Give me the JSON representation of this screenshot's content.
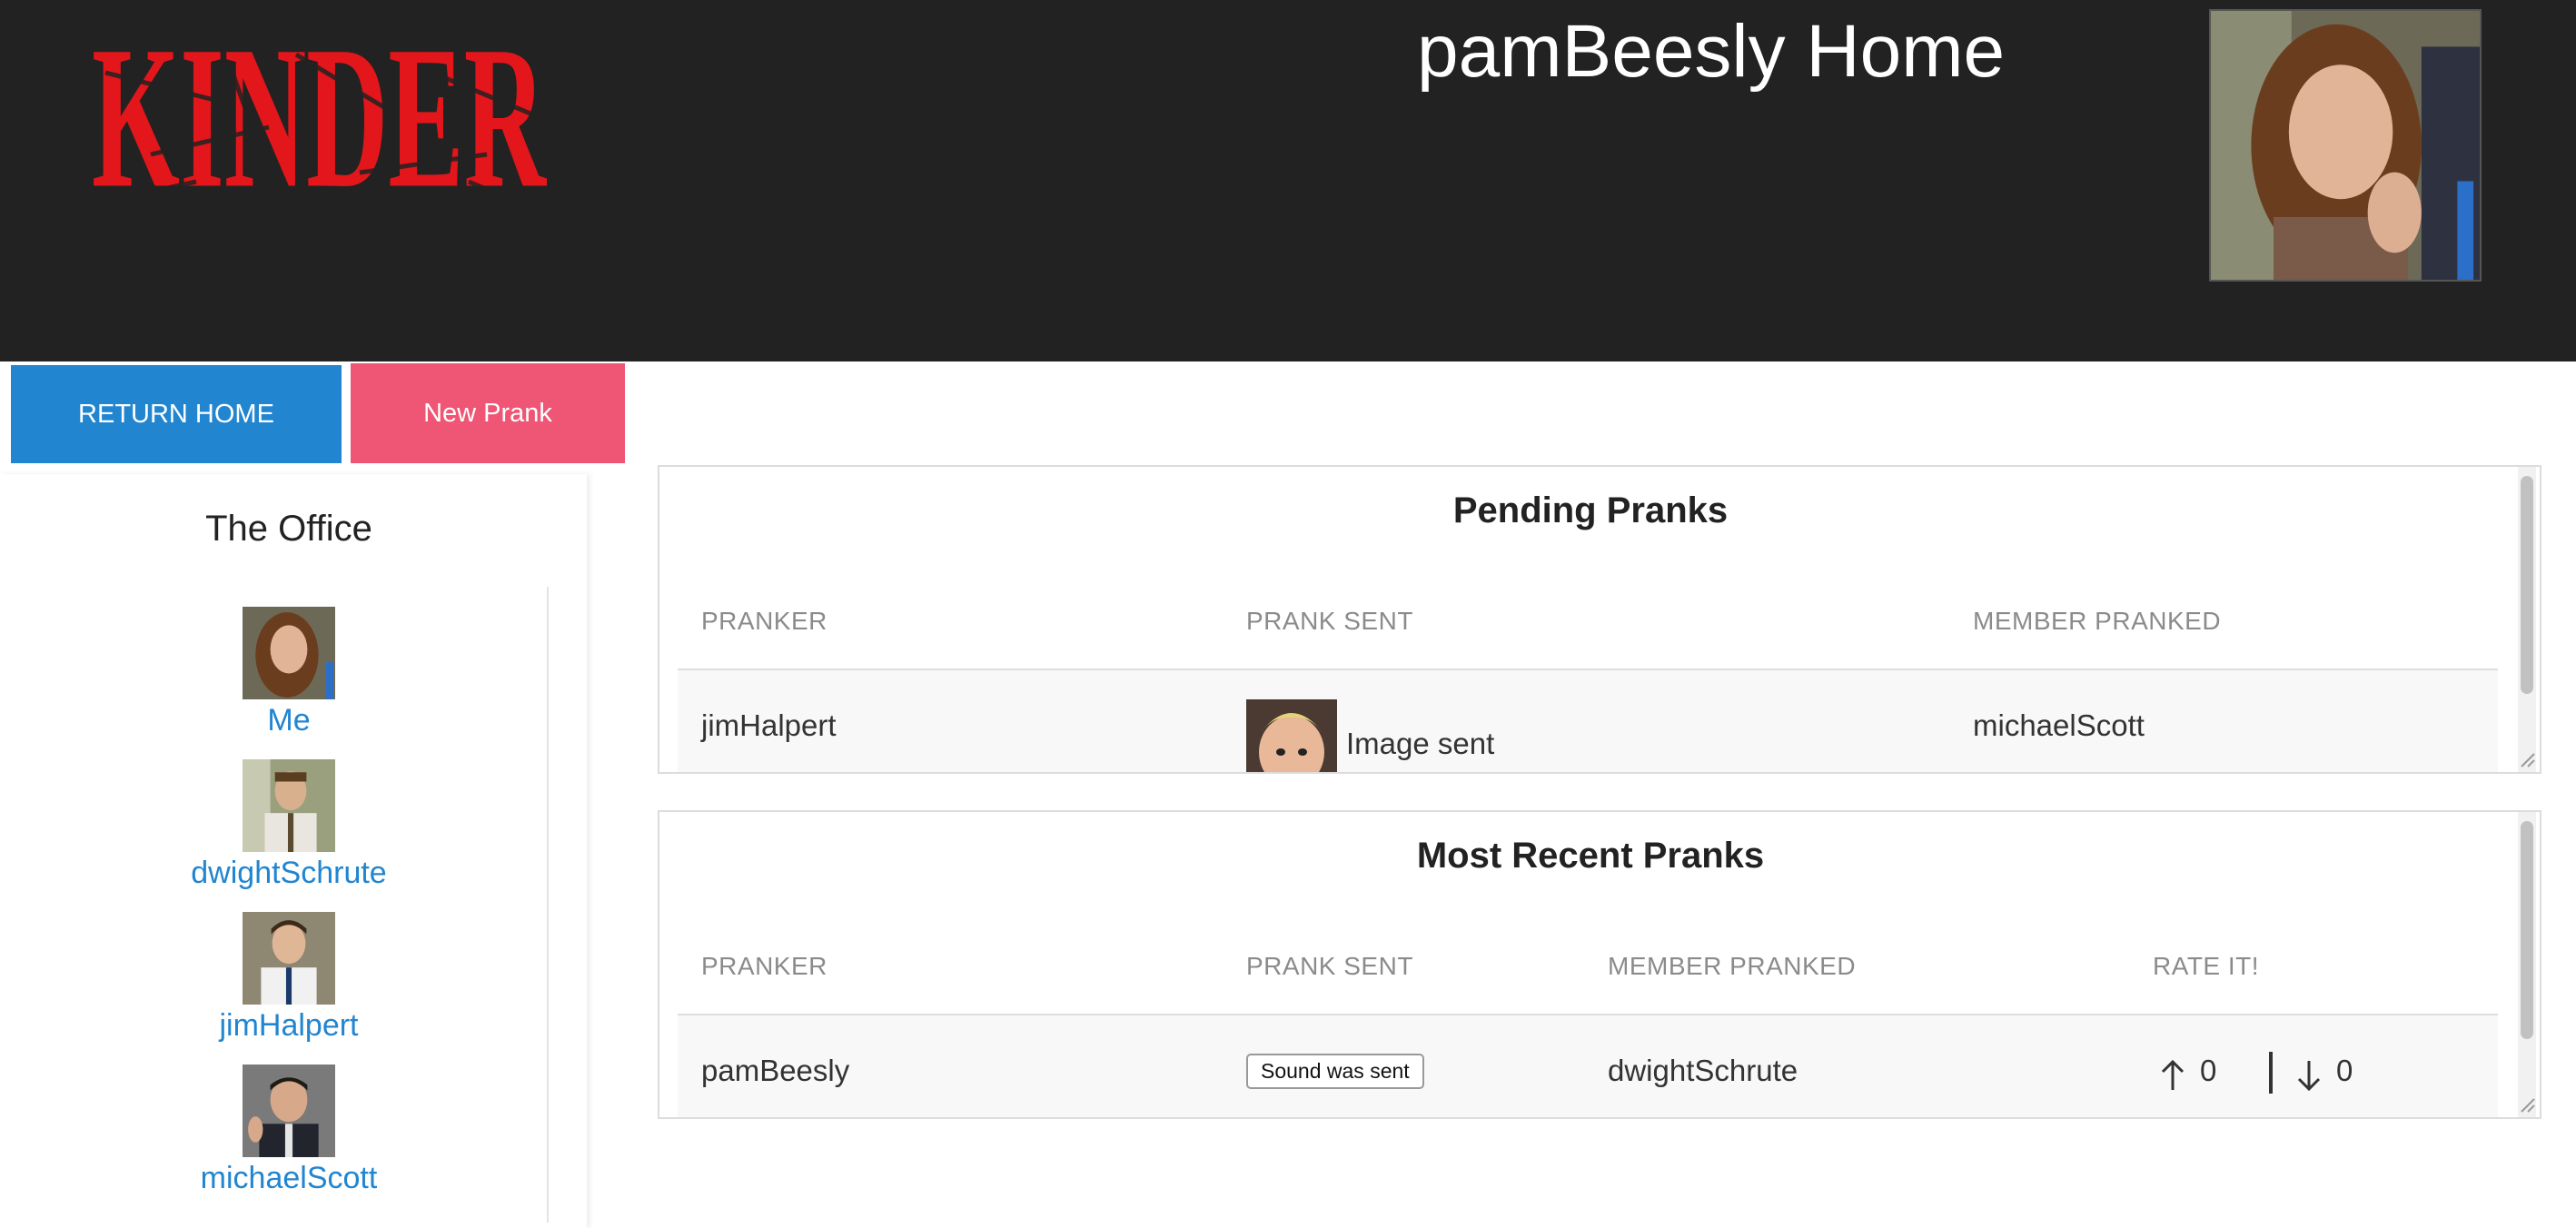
{
  "header": {
    "logo_text": "KINDER",
    "page_title": "pamBeesly Home"
  },
  "buttons": {
    "return_home": "RETURN HOME",
    "new_prank": "New Prank"
  },
  "sidebar": {
    "title": "The Office",
    "members": [
      {
        "name": "Me"
      },
      {
        "name": "dwightSchrute"
      },
      {
        "name": "jimHalpert"
      },
      {
        "name": "michaelScott"
      }
    ]
  },
  "pending": {
    "title": "Pending Pranks",
    "columns": [
      "PRANKER",
      "PRANK SENT",
      "MEMBER PRANKED"
    ],
    "rows": [
      {
        "pranker": "jimHalpert",
        "prank_sent": "Image sent",
        "member_pranked": "michaelScott"
      }
    ]
  },
  "recent": {
    "title": "Most Recent Pranks",
    "columns": [
      "PRANKER",
      "PRANK SENT",
      "MEMBER PRANKED",
      "RATE IT!"
    ],
    "rows": [
      {
        "pranker": "pamBeesly",
        "prank_sent": "Sound was sent",
        "member_pranked": "dwightSchrute",
        "up": "0",
        "down": "0"
      }
    ]
  },
  "colors": {
    "header_bg": "#222222",
    "primary": "#2185d0",
    "accent": "#ef5574",
    "logo": "#e2161b"
  }
}
